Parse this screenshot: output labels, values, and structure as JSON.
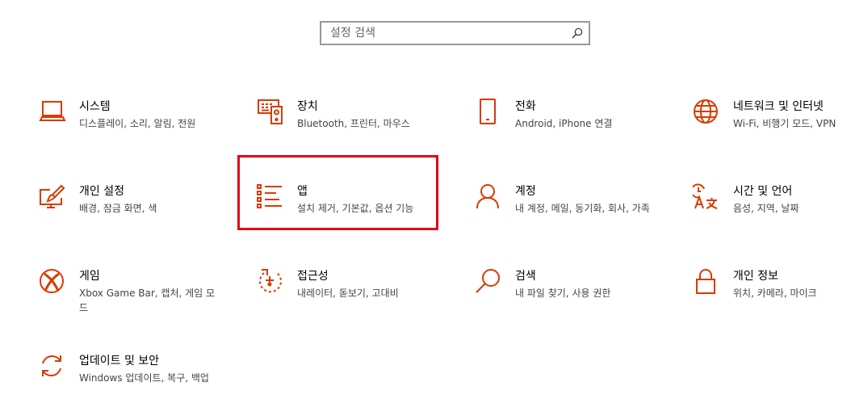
{
  "search": {
    "placeholder": "설정 검색",
    "icon": "search-icon"
  },
  "accent_color": "#d83b01",
  "selection_color": "#e60012",
  "categories": [
    {
      "title": "시스템",
      "desc": "디스플레이, 소리, 알림, 전원",
      "icon": "laptop-icon"
    },
    {
      "title": "장치",
      "desc": "Bluetooth, 프린터, 마우스",
      "icon": "devices-icon"
    },
    {
      "title": "전화",
      "desc": "Android, iPhone 연결",
      "icon": "phone-icon"
    },
    {
      "title": "네트워크 및 인터넷",
      "desc": "Wi-Fi, 비행기 모드, VPN",
      "icon": "globe-icon"
    },
    {
      "title": "개인 설정",
      "desc": "배경, 잠금 화면, 색",
      "icon": "personalization-icon"
    },
    {
      "title": "앱",
      "desc": "설치 제거, 기본값, 옵션 기능",
      "icon": "apps-list-icon",
      "selected": true
    },
    {
      "title": "계정",
      "desc": "내 계정, 메일, 동기화, 회사, 가족",
      "icon": "person-icon"
    },
    {
      "title": "시간 및 언어",
      "desc": "음성, 지역, 날짜",
      "icon": "time-language-icon"
    },
    {
      "title": "게임",
      "desc": "Xbox Game Bar, 캡처, 게임 모드",
      "icon": "xbox-icon"
    },
    {
      "title": "접근성",
      "desc": "내레이터, 돋보기, 고대비",
      "icon": "accessibility-icon"
    },
    {
      "title": "검색",
      "desc": "내 파일 찾기, 사용 권한",
      "icon": "search-magnifier-icon"
    },
    {
      "title": "개인 정보",
      "desc": "위치, 카메라, 마이크",
      "icon": "lock-icon"
    },
    {
      "title": "업데이트 및 보안",
      "desc": "Windows 업데이트, 복구, 백업",
      "icon": "sync-icon"
    }
  ]
}
